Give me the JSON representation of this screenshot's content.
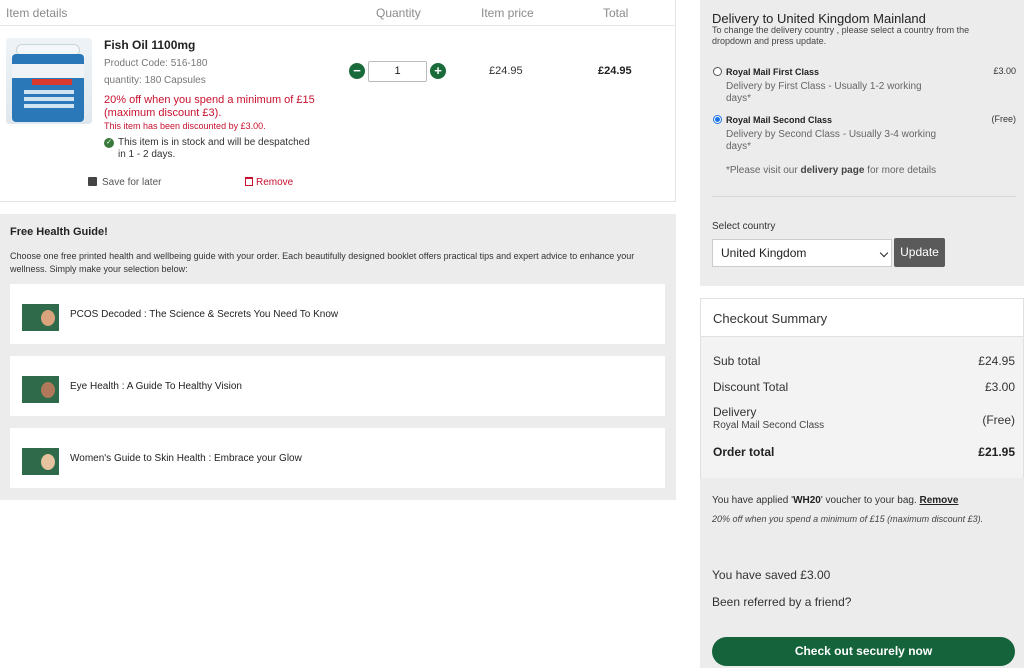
{
  "bag": {
    "headers": {
      "item": "Item details",
      "quantity": "Quantity",
      "price": "Item price",
      "total": "Total"
    },
    "item": {
      "name": "Fish Oil 1100mg",
      "code": "Product Code: 516-180",
      "quantity_text": "quantity: 180 Capsules",
      "promo": "20% off when you spend a minimum of £15 (maximum discount £3).",
      "discounted": "This item has been discounted by £3.00.",
      "stock": "This item is in stock and will be despatched in 1 - 2 days.",
      "qty": "1",
      "price": "£24.95",
      "total": "£24.95",
      "minus": "−",
      "plus": "+",
      "save_later": "Save for later",
      "remove": "Remove",
      "stock_icon": "check-icon",
      "image_icon": "product-jar-image"
    }
  },
  "guide": {
    "title": "Free Health Guide!",
    "description": "Choose one free printed health and wellbeing guide with your order. Each beautifully designed booklet offers practical tips and expert advice to enhance your wellness. Simply make your selection below:",
    "items": [
      {
        "label": "PCOS Decoded : The Science & Secrets You Need To Know"
      },
      {
        "label": "Eye Health : A Guide To Healthy Vision"
      },
      {
        "label": "Women's Guide to Skin Health : Embrace your Glow"
      }
    ]
  },
  "delivery": {
    "title": "Delivery to United Kingdom Mainland",
    "subtitle": "To change the delivery country , please select a country from the dropdown and press update.",
    "options": [
      {
        "name": "Royal Mail First Class",
        "price": "£3.00",
        "desc": "Delivery by First Class - Usually 1-2 working days*",
        "selected": false
      },
      {
        "name": "Royal Mail Second Class",
        "price": "(Free)",
        "desc": "Delivery by Second Class - Usually 3-4 working days*",
        "selected": true
      }
    ],
    "note_pre": "*Please visit our ",
    "note_link": "delivery page",
    "note_post": " for more details",
    "select_label": "Select country",
    "country": "United Kingdom",
    "update": "Update"
  },
  "summary": {
    "title": "Checkout Summary",
    "subtotal_label": "Sub total",
    "subtotal": "£24.95",
    "discount_label": "Discount Total",
    "discount": "£3.00",
    "delivery_label": "Delivery",
    "delivery_method": "Royal Mail Second Class",
    "delivery": "(Free)",
    "order_label": "Order total",
    "order_total": "£21.95"
  },
  "voucher": {
    "pre": "You have applied '",
    "code": "WH20",
    "post": "' voucher to your bag. ",
    "remove": "Remove",
    "desc": "20% off when you spend a minimum of £15 (maximum discount £3).",
    "saved": "You have saved £3.00",
    "referred": "Been referred by a friend?",
    "checkout": "Check out securely now"
  },
  "colors": {
    "brand_green": "#15633a",
    "promo_red": "#c8102e",
    "panel_grey": "#ececec"
  }
}
